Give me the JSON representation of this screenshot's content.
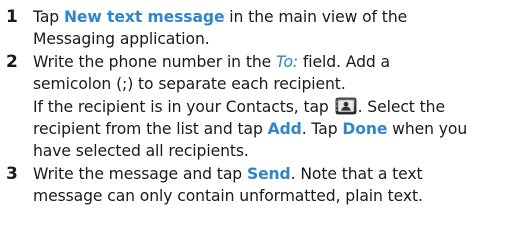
{
  "steps": [
    {
      "number": "1",
      "lines": {
        "l1_pre": "Tap ",
        "l1_kw": "New text message",
        "l1_post": " in the main view of the",
        "l2": "Messaging application."
      }
    },
    {
      "number": "2",
      "lines": {
        "l1_pre": "Write the phone number in the ",
        "l1_field": "To:",
        "l1_post": " field. Add a",
        "l2": "semicolon (;) to separate each recipient.",
        "l3_pre": "If the recipient is in your Contacts, tap ",
        "l3_icon": "contacts-icon",
        "l3_post": ". Select the",
        "l4_pre": "recipient from the list and tap ",
        "l4_kw1": "Add",
        "l4_mid": ". Tap ",
        "l4_kw2": "Done",
        "l4_post": " when you",
        "l5": "have selected all recipients."
      }
    },
    {
      "number": "3",
      "lines": {
        "l1_pre": "Write the message and tap ",
        "l1_kw": "Send",
        "l1_post": ". Note that a text",
        "l2": "message can only contain unformatted, plain text."
      }
    }
  ],
  "colors": {
    "keyword": "#2f86c9",
    "text": "#1a1a1a"
  }
}
